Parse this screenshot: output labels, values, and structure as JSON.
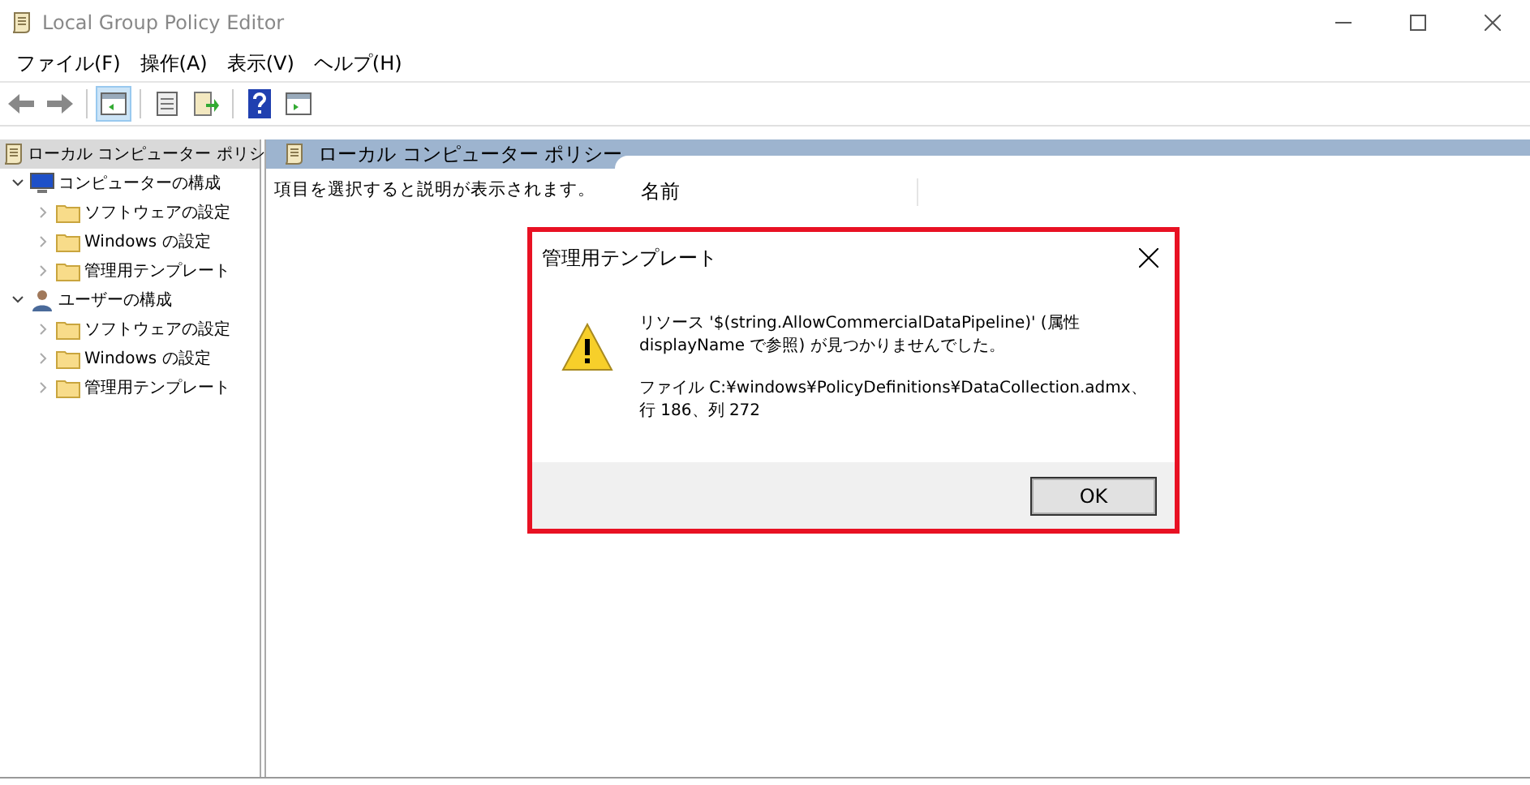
{
  "window": {
    "title": "Local Group Policy Editor"
  },
  "menu": [
    "ファイル(F)",
    "操作(A)",
    "表示(V)",
    "ヘルプ(H)"
  ],
  "toolbar": [
    {
      "kind": "back",
      "selected": false
    },
    {
      "kind": "forward",
      "selected": false
    },
    {
      "kind": "sep"
    },
    {
      "kind": "tree",
      "selected": true
    },
    {
      "kind": "sep"
    },
    {
      "kind": "properties",
      "selected": false
    },
    {
      "kind": "export",
      "selected": false
    },
    {
      "kind": "sep"
    },
    {
      "kind": "help",
      "selected": false
    },
    {
      "kind": "pane",
      "selected": false
    }
  ],
  "tree": {
    "label": "ローカル コンピューター ポリシ",
    "selected": true,
    "children": [
      {
        "label": "コンピューターの構成",
        "kind": "computer",
        "expanded": true,
        "children": [
          {
            "label": "ソフトウェアの設定",
            "expanded": false
          },
          {
            "label": "Windows の設定",
            "expanded": false
          },
          {
            "label": "管理用テンプレート",
            "expanded": false
          }
        ]
      },
      {
        "label": "ユーザーの構成",
        "kind": "user",
        "expanded": true,
        "children": [
          {
            "label": "ソフトウェアの設定",
            "expanded": false
          },
          {
            "label": "Windows の設定",
            "expanded": false
          },
          {
            "label": "管理用テンプレート",
            "expanded": false
          }
        ]
      }
    ]
  },
  "pane": {
    "title": "ローカル コンピューター ポリシー",
    "description": "項目を選択すると説明が表示されます。",
    "columns": [
      "名前"
    ]
  },
  "dialog": {
    "title": "管理用テンプレート",
    "message": "リソース '$(string.AllowCommercialDataPipeline)' (属性 displayName で参照) が見つかりませんでした。",
    "detail": "ファイル C:¥windows¥PolicyDefinitions¥DataCollection.admx、行 186、列 272",
    "buttons": [
      "OK"
    ]
  }
}
